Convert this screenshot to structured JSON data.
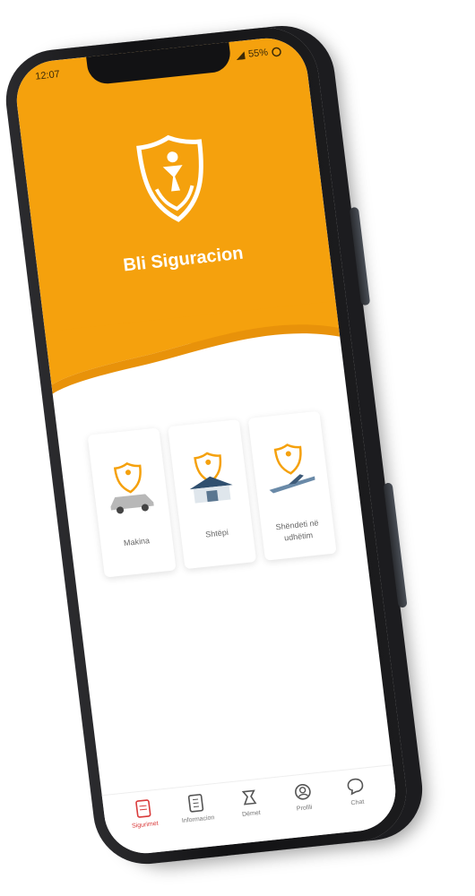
{
  "status_bar": {
    "time": "12:07",
    "battery": "55%"
  },
  "app": {
    "name": "Bli Siguracion"
  },
  "colors": {
    "accent": "#f5a10d",
    "active_tab": "#d93b3b"
  },
  "cards": [
    {
      "label": "Makina",
      "icon": "car-icon"
    },
    {
      "label": "Shtëpi",
      "icon": "house-icon"
    },
    {
      "label": "Shëndeti në udhëtim",
      "icon": "airplane-icon"
    }
  ],
  "bottom_nav": [
    {
      "label": "Sigurimet",
      "icon": "document-icon",
      "active": true
    },
    {
      "label": "Informacion",
      "icon": "info-icon",
      "active": false
    },
    {
      "label": "Dëmet",
      "icon": "damage-icon",
      "active": false
    },
    {
      "label": "Profili",
      "icon": "profile-icon",
      "active": false
    },
    {
      "label": "Chat",
      "icon": "chat-icon",
      "active": false
    }
  ]
}
